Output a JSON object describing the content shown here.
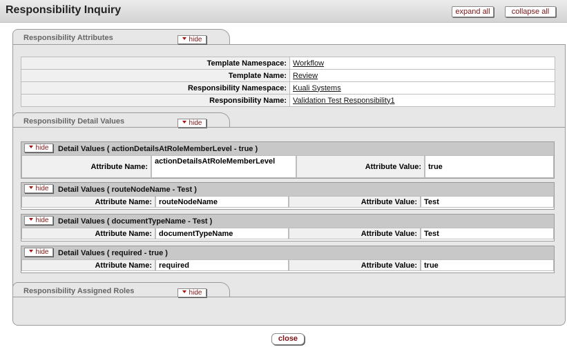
{
  "page": {
    "title": "Responsibility Inquiry",
    "expand_all": "expand all",
    "collapse_all": "collapse all",
    "close": "close"
  },
  "sections": {
    "attributes": {
      "title": "Responsibility Attributes",
      "hide": "hide"
    },
    "detail_values": {
      "title": "Responsibility Detail Values",
      "hide": "hide"
    },
    "assigned_roles": {
      "title": "Responsibility Assigned Roles",
      "hide": "hide"
    }
  },
  "attributes": [
    {
      "label": "Template Namespace:",
      "value": "Workflow"
    },
    {
      "label": "Template Name:",
      "value": "Review"
    },
    {
      "label": "Responsibility Namespace:",
      "value": "Kuali Systems"
    },
    {
      "label": "Responsibility Name:",
      "value": "Validation Test Responsibility1"
    }
  ],
  "detail_groups": [
    {
      "hide": "hide",
      "title": "Detail Values ( actionDetailsAtRoleMemberLevel - true )",
      "name_label": "Attribute Name:",
      "name_value": "actionDetailsAtRoleMemberLevel",
      "value_label": "Attribute Value:",
      "value_value": "true"
    },
    {
      "hide": "hide",
      "title": "Detail Values ( routeNodeName - Test )",
      "name_label": "Attribute Name:",
      "name_value": "routeNodeName",
      "value_label": "Attribute Value:",
      "value_value": "Test"
    },
    {
      "hide": "hide",
      "title": "Detail Values ( documentTypeName - Test )",
      "name_label": "Attribute Name:",
      "name_value": "documentTypeName",
      "value_label": "Attribute Value:",
      "value_value": "Test"
    },
    {
      "hide": "hide",
      "title": "Detail Values ( required - true )",
      "name_label": "Attribute Name:",
      "name_value": "required",
      "value_label": "Attribute Value:",
      "value_value": "true"
    }
  ]
}
